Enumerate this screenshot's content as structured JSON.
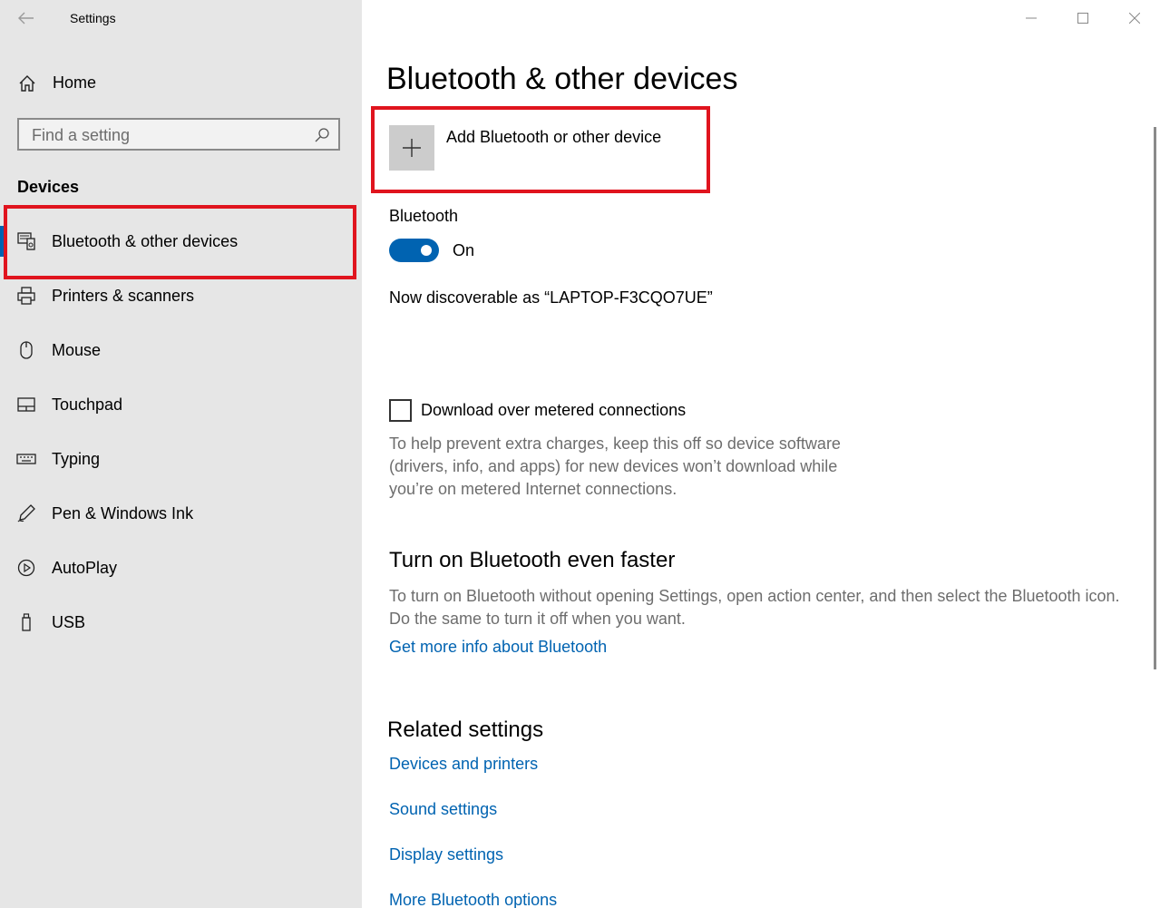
{
  "window": {
    "app_title": "Settings",
    "controls": [
      "minimize-icon",
      "maximize-icon",
      "close-icon"
    ]
  },
  "sidebar": {
    "home_label": "Home",
    "search_placeholder": "Find a setting",
    "section_heading": "Devices",
    "items": [
      {
        "label": "Bluetooth & other devices",
        "icon": "bluetooth-devices-icon",
        "selected": true
      },
      {
        "label": "Printers & scanners",
        "icon": "printer-icon",
        "selected": false
      },
      {
        "label": "Mouse",
        "icon": "mouse-icon",
        "selected": false
      },
      {
        "label": "Touchpad",
        "icon": "touchpad-icon",
        "selected": false
      },
      {
        "label": "Typing",
        "icon": "keyboard-icon",
        "selected": false
      },
      {
        "label": "Pen & Windows Ink",
        "icon": "pen-icon",
        "selected": false
      },
      {
        "label": "AutoPlay",
        "icon": "autoplay-icon",
        "selected": false
      },
      {
        "label": "USB",
        "icon": "usb-icon",
        "selected": false
      }
    ]
  },
  "main": {
    "title": "Bluetooth & other devices",
    "add_device_label": "Add Bluetooth or other device",
    "bluetooth_label": "Bluetooth",
    "bluetooth_state": "On",
    "discoverable_text": "Now discoverable as “LAPTOP-F3CQO7UE”",
    "metered_label": "Download over metered connections",
    "metered_help": "To help prevent extra charges, keep this off so device software (drivers, info, and apps) for new devices won’t download while you’re on metered Internet connections.",
    "faster_heading": "Turn on Bluetooth even faster",
    "faster_text": "To turn on Bluetooth without opening Settings, open action center, and then select the Bluetooth icon. Do the same to turn it off when you want.",
    "more_info_link": "Get more info about Bluetooth",
    "related_heading": "Related settings",
    "related_links": [
      "Devices and printers",
      "Sound settings",
      "Display settings",
      "More Bluetooth options"
    ]
  },
  "colors": {
    "sidebar_bg": "#e6e6e6",
    "accent": "#0063b1",
    "highlight": "#e0141e",
    "secondary_text": "#6d6d6d"
  }
}
